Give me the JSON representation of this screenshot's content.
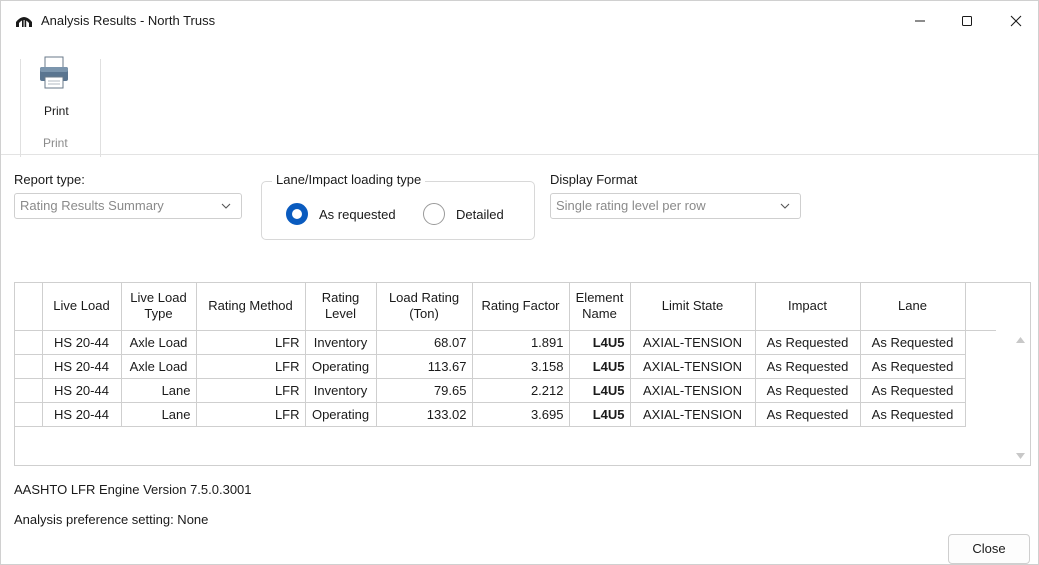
{
  "window": {
    "title": "Analysis Results - North Truss"
  },
  "ribbon": {
    "print_label": "Print",
    "group_label": "Print"
  },
  "report_type": {
    "label": "Report type:",
    "value": "Rating Results Summary"
  },
  "loading_type": {
    "label": "Lane/Impact loading type",
    "options": [
      "As requested",
      "Detailed"
    ],
    "selected": "As requested"
  },
  "display_format": {
    "label": "Display Format",
    "value": "Single rating level per row"
  },
  "table": {
    "headers": [
      "Live Load",
      "Live Load Type",
      "Rating Method",
      "Rating Level",
      "Load Rating (Ton)",
      "Rating Factor",
      "Element Name",
      "Limit State",
      "Impact",
      "Lane"
    ],
    "rows": [
      [
        "HS 20-44",
        "Axle Load",
        "LFR",
        "Inventory",
        "68.07",
        "1.891",
        "L4U5",
        "AXIAL-TENSION",
        "As Requested",
        "As Requested"
      ],
      [
        "HS 20-44",
        "Axle Load",
        "LFR",
        "Operating",
        "113.67",
        "3.158",
        "L4U5",
        "AXIAL-TENSION",
        "As Requested",
        "As Requested"
      ],
      [
        "HS 20-44",
        "Lane",
        "LFR",
        "Inventory",
        "79.65",
        "2.212",
        "L4U5",
        "AXIAL-TENSION",
        "As Requested",
        "As Requested"
      ],
      [
        "HS 20-44",
        "Lane",
        "LFR",
        "Operating",
        "133.02",
        "3.695",
        "L4U5",
        "AXIAL-TENSION",
        "As Requested",
        "As Requested"
      ]
    ]
  },
  "footer": {
    "engine_version": "AASHTO LFR Engine Version 7.5.0.3001",
    "preference": "Analysis preference setting: None",
    "close_label": "Close"
  },
  "colors": {
    "accent": "#0a5bbf",
    "border": "#cfcfcf"
  }
}
